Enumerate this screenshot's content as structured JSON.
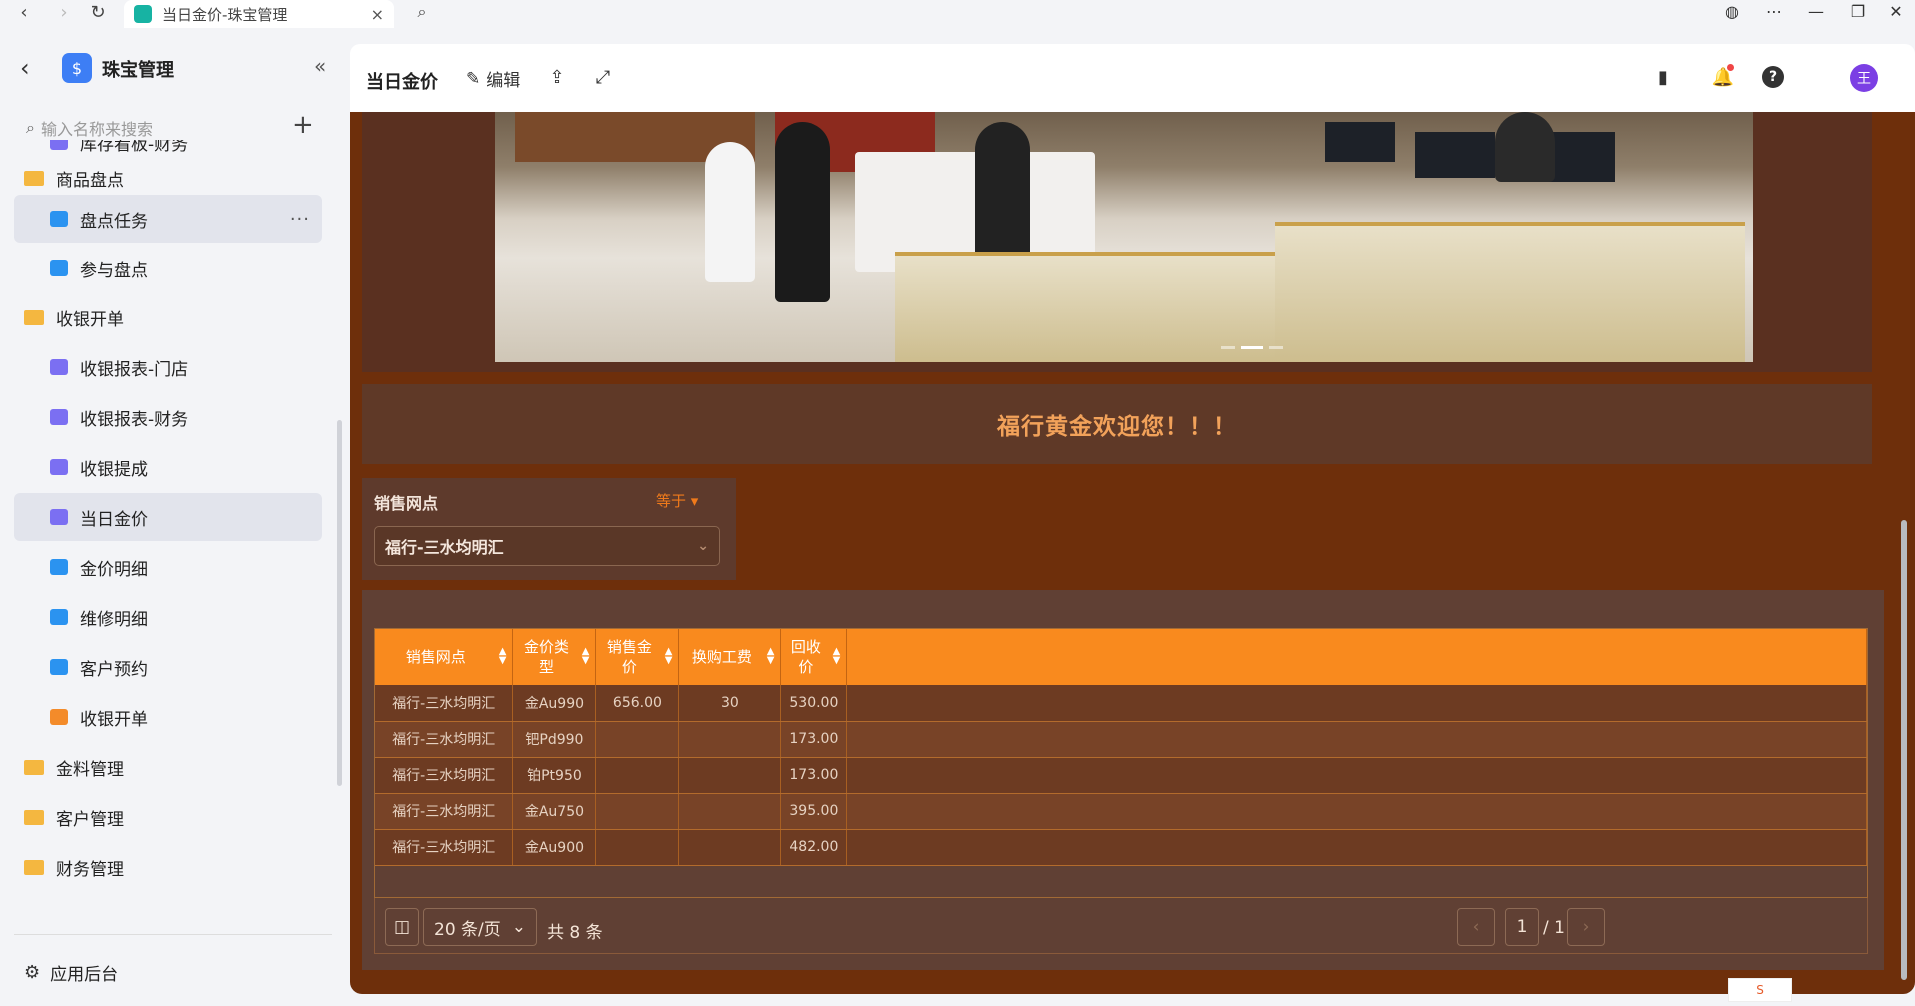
{
  "browser": {
    "tab_title": "当日金价-珠宝管理",
    "close_icon": "×"
  },
  "sidebar": {
    "app_name": "珠宝管理",
    "search_placeholder": "输入名称来搜索",
    "items": [
      {
        "label": "库存看板-财务",
        "type": "chart",
        "level": "sub"
      },
      {
        "label": "商品盘点",
        "type": "folder",
        "level": "top"
      },
      {
        "label": "盘点任务",
        "type": "doc",
        "level": "sub",
        "active": true
      },
      {
        "label": "参与盘点",
        "type": "doc",
        "level": "sub"
      },
      {
        "label": "收银开单",
        "type": "folder",
        "level": "top"
      },
      {
        "label": "收银报表-门店",
        "type": "chart",
        "level": "sub"
      },
      {
        "label": "收银报表-财务",
        "type": "chart",
        "level": "sub"
      },
      {
        "label": "收银提成",
        "type": "chart",
        "level": "sub"
      },
      {
        "label": "当日金价",
        "type": "chart",
        "level": "sub",
        "active": true
      },
      {
        "label": "金价明细",
        "type": "doc",
        "level": "sub"
      },
      {
        "label": "维修明细",
        "type": "doc",
        "level": "sub"
      },
      {
        "label": "客户预约",
        "type": "doc",
        "level": "sub"
      },
      {
        "label": "收银开单",
        "type": "form",
        "level": "sub"
      },
      {
        "label": "金料管理",
        "type": "folder",
        "level": "top"
      },
      {
        "label": "客户管理",
        "type": "folder",
        "level": "top"
      },
      {
        "label": "财务管理",
        "type": "folder",
        "level": "top"
      }
    ],
    "admin_label": "应用后台"
  },
  "header": {
    "title": "当日金价",
    "edit_label": "编辑"
  },
  "content": {
    "welcome_text": "福行黄金欢迎您！！！",
    "filter": {
      "label": "销售网点",
      "operator": "等于",
      "selected": "福行-三水均明汇"
    },
    "table": {
      "columns": [
        "销售网点",
        "金价类型",
        "销售金价",
        "换购工费",
        "回收价"
      ],
      "rows": [
        [
          "福行-三水均明汇",
          "金Au990",
          "656.00",
          "30",
          "530.00"
        ],
        [
          "福行-三水均明汇",
          "钯Pd990",
          "",
          "",
          "173.00"
        ],
        [
          "福行-三水均明汇",
          "铂Pt950",
          "",
          "",
          "173.00"
        ],
        [
          "福行-三水均明汇",
          "金Au750",
          "",
          "",
          "395.00"
        ],
        [
          "福行-三水均明汇",
          "金Au900",
          "",
          "",
          "482.00"
        ]
      ]
    },
    "pager": {
      "page_size": "20 条/页",
      "total": "共 8 条",
      "current_page": "1",
      "total_pages": "/ 1"
    }
  },
  "colors": {
    "content_bg": "#6e2f0b",
    "table_header": "#f98a1e",
    "welcome_text": "#f2a25a",
    "accent": "#3d7ef5"
  }
}
